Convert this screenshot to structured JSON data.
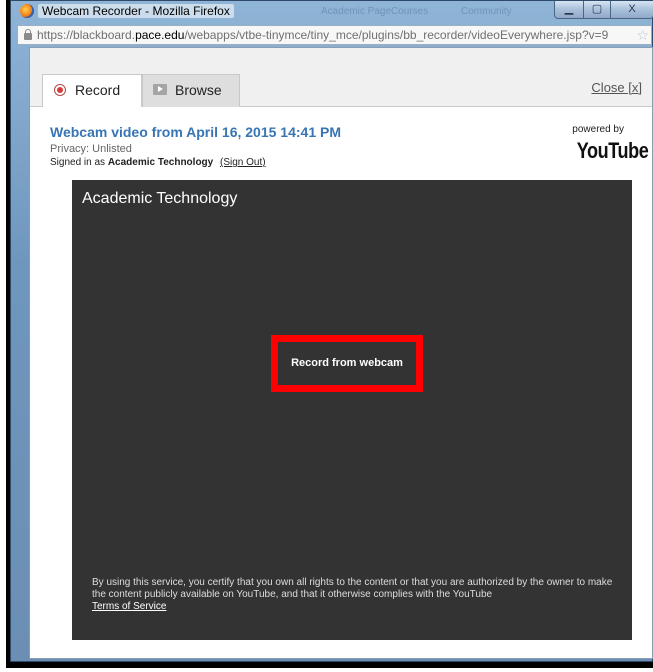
{
  "window": {
    "title": "Webcam Recorder - Mozilla Firefox",
    "background_tabs": [
      "Academic Page",
      "Courses",
      "Community"
    ],
    "controls": {
      "minimize": "▁",
      "maximize": "▢",
      "close": "X"
    }
  },
  "urlbar": {
    "prefix": "https://blackboard.",
    "domain": "pace.edu",
    "path": "/webapps/vtbe-tinymce/tiny_mce/plugins/bb_recorder/videoEverywhere.jsp?v=9"
  },
  "tabs": {
    "record_label": "Record",
    "browse_label": "Browse",
    "close_label": "Close [x]"
  },
  "video": {
    "title": "Webcam video from April 16, 2015 14:41 PM",
    "privacy": "Privacy: Unlisted",
    "signed_in_prefix": "Signed in as",
    "user": "Academic Technology",
    "sign_out": "(Sign Out)"
  },
  "branding": {
    "powered_by": "powered by",
    "logo_text": "YouTube"
  },
  "player": {
    "channel_name": "Academic Technology",
    "record_button": "Record from webcam",
    "tos_text": "By using this service, you certify that you own all rights to the content or that you are authorized by the owner to make the content publicly available on YouTube, and that it otherwise complies with the YouTube",
    "tos_link": "Terms of Service"
  },
  "colors": {
    "accent_red": "#ff0000",
    "title_blue": "#3775b4",
    "player_bg": "#333333"
  }
}
